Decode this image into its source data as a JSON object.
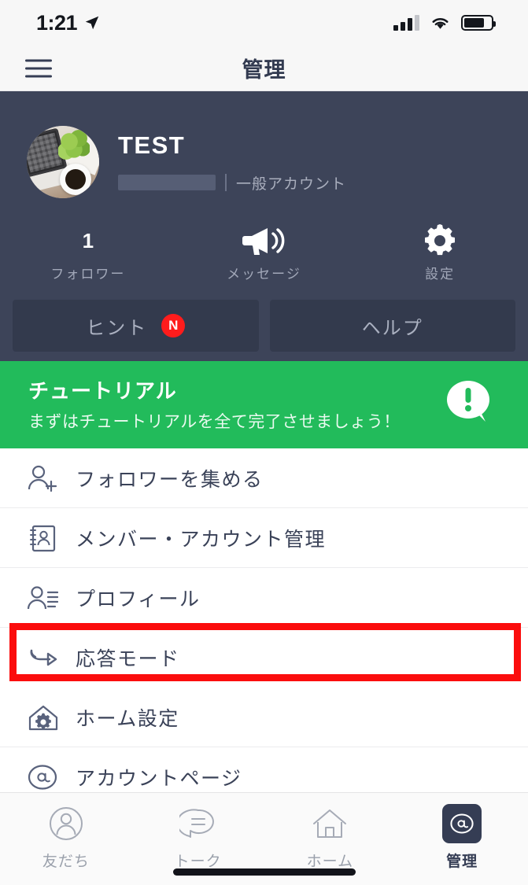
{
  "status_bar": {
    "time": "1:21",
    "location_icon": "location-arrow-icon",
    "signal_icon": "cellular-signal-icon",
    "wifi_icon": "wifi-icon",
    "battery_icon": "battery-icon"
  },
  "nav": {
    "menu_icon": "hamburger-menu-icon",
    "title": "管理"
  },
  "profile": {
    "avatar_alt": "avatar-desk-photo",
    "name": "TEST",
    "id_redacted": "",
    "divider": "|",
    "account_type": "一般アカウント",
    "stats": [
      {
        "value": "1",
        "label": "フォロワー",
        "icon": ""
      },
      {
        "value": "",
        "label": "メッセージ",
        "icon": "megaphone-icon"
      },
      {
        "value": "",
        "label": "設定",
        "icon": "gear-icon"
      }
    ],
    "actions": [
      {
        "label": "ヒント",
        "badge": "N"
      },
      {
        "label": "ヘルプ",
        "badge": ""
      }
    ]
  },
  "tutorial": {
    "title": "チュートリアル",
    "subtitle": "まずはチュートリアルを全て完了させましょう！",
    "icon": "exclamation-speech-bubble-icon"
  },
  "menu": {
    "items": [
      {
        "label": "フォロワーを集める",
        "icon": "person-add-icon",
        "highlighted": false
      },
      {
        "label": "メンバー・アカウント管理",
        "icon": "address-book-icon",
        "highlighted": false
      },
      {
        "label": "プロフィール",
        "icon": "profile-lines-icon",
        "highlighted": false
      },
      {
        "label": "応答モード",
        "icon": "reply-arrow-icon",
        "highlighted": true
      },
      {
        "label": "ホーム設定",
        "icon": "house-gear-icon",
        "highlighted": false
      },
      {
        "label": "アカウントページ",
        "icon": "at-circle-icon",
        "highlighted": false
      }
    ]
  },
  "tabbar": {
    "tabs": [
      {
        "label": "友だち",
        "icon": "person-circle-icon",
        "active": false
      },
      {
        "label": "トーク",
        "icon": "chat-bubble-icon",
        "active": false
      },
      {
        "label": "ホーム",
        "icon": "house-icon",
        "active": false
      },
      {
        "label": "管理",
        "icon": "at-square-icon",
        "active": true
      }
    ]
  },
  "colors": {
    "header_bg": "#3d4459",
    "tutorial_green": "#22bb5b",
    "highlight_red": "#fb0d0d",
    "badge_red": "#ff1c1c",
    "text_navy": "#3a4258"
  }
}
